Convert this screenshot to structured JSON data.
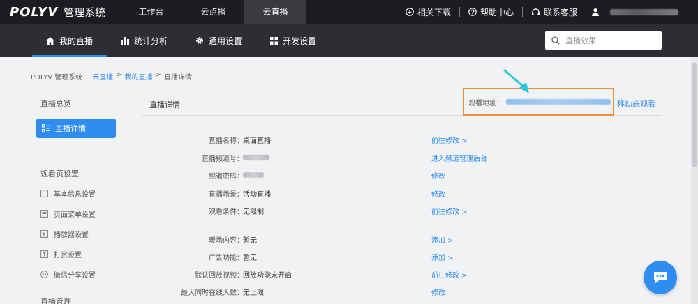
{
  "topbar": {
    "brand": "POLYV",
    "system_name": "管理系统",
    "nav": [
      {
        "label": "工作台",
        "active": false
      },
      {
        "label": "云点播",
        "active": false
      },
      {
        "label": "云直播",
        "active": true
      }
    ],
    "right": {
      "download": "相关下载",
      "help": "帮助中心",
      "service": "联系客服"
    }
  },
  "subbar": {
    "nav": [
      {
        "label": "我的直播",
        "icon": "home-icon",
        "active": true
      },
      {
        "label": "统计分析",
        "icon": "bar-chart-icon",
        "active": false
      },
      {
        "label": "通用设置",
        "icon": "gear-icon",
        "active": false
      },
      {
        "label": "开发设置",
        "icon": "grid-icon",
        "active": false
      }
    ],
    "search_placeholder": "直播效果"
  },
  "breadcrumb": {
    "prefix": "POLYV 管理系统：",
    "items": [
      "云直播",
      "我的直播",
      "直播详情"
    ],
    "separator": ">"
  },
  "sidebar": {
    "overview": "直播总览",
    "active_item": "直播详情",
    "group_title": "观看页设置",
    "items": [
      {
        "label": "基本信息设置",
        "icon": "window-icon"
      },
      {
        "label": "页面菜单设置",
        "icon": "list-icon"
      },
      {
        "label": "播放器设置",
        "icon": "play-icon"
      },
      {
        "label": "打赏设置",
        "icon": "gift-icon"
      },
      {
        "label": "微信分享设置",
        "icon": "share-icon"
      }
    ],
    "group2_title": "直播管理"
  },
  "main": {
    "title": "直播详情",
    "watch_label": "观看地址：",
    "mobile_watch": "移动端观看",
    "rows": [
      {
        "label": "直播名称：",
        "value": "桌面直播",
        "action": "前往修改 >"
      },
      {
        "label": "直播频道号：",
        "value": "",
        "action": "进入频道管理后台"
      },
      {
        "label": "频道密码：",
        "value": "",
        "action": "修改"
      },
      {
        "label": "直播场景：",
        "value": "活动直播",
        "action": "修改"
      },
      {
        "label": "观看条件：",
        "value": "无限制",
        "action": "前往修改 >"
      },
      {
        "label": "暖场内容：",
        "value": "暂无",
        "action": "添加 >"
      },
      {
        "label": "广告功能：",
        "value": "暂无",
        "action": "添加 >"
      },
      {
        "label": "默认回放视频：",
        "value": "回放功能未开启",
        "action": "前往修改 >"
      },
      {
        "label": "最大同时在线人数：",
        "value": "无上限",
        "action": "修改"
      }
    ]
  },
  "colors": {
    "accent": "#2f8cf0",
    "topbar": "#1c1d21",
    "subbar": "#2d2e33",
    "highlight_box": "#f08e3e",
    "arrow": "#2ec6d6"
  }
}
